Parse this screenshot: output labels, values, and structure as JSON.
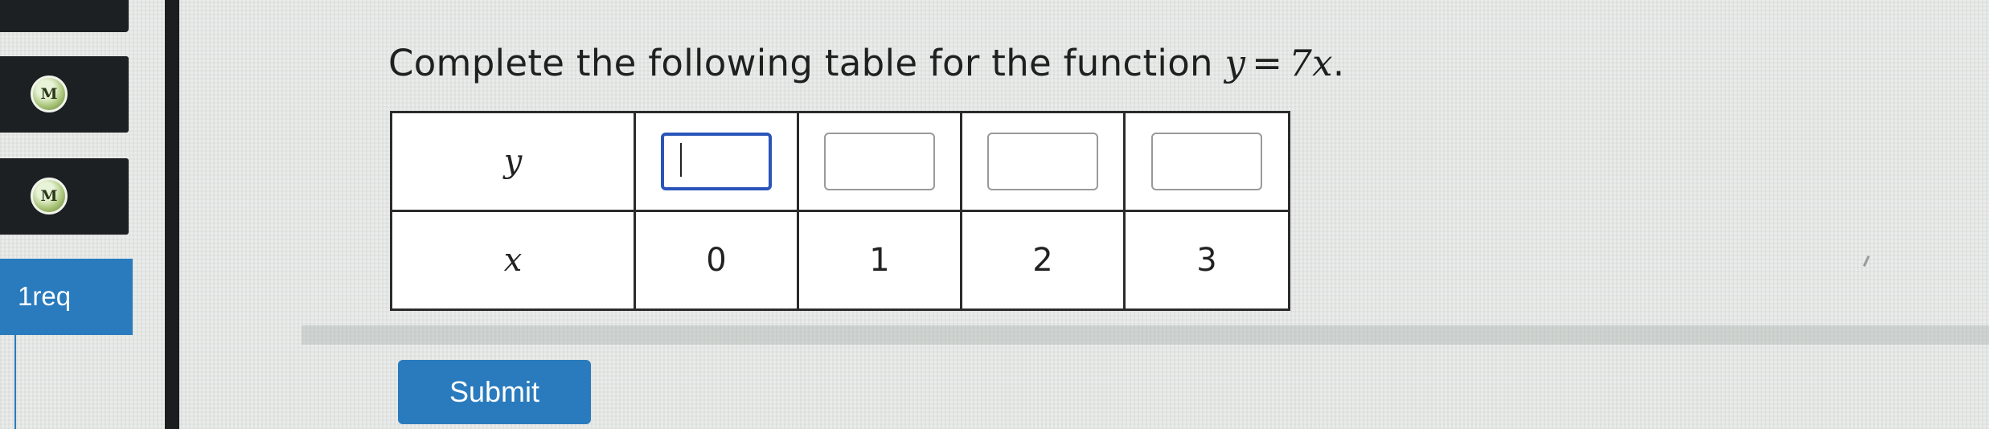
{
  "sidebar": {
    "items": [
      {
        "badge": "M"
      },
      {
        "badge": "M"
      }
    ],
    "active_item_label": "1req"
  },
  "question": {
    "prefix": "Complete the following table for the function ",
    "lhs": "y",
    "operator": "=",
    "rhs": "7x",
    "suffix": "."
  },
  "table": {
    "row_y_label": "y",
    "row_x_label": "x",
    "x_values": [
      "0",
      "1",
      "2",
      "3"
    ],
    "y_inputs": [
      "",
      "",
      "",
      ""
    ]
  },
  "submit": {
    "label": "Submit"
  },
  "colors": {
    "accent": "#2a7bbd",
    "focus_border": "#2a55b8",
    "sidebar_dark": "#1d2022"
  }
}
